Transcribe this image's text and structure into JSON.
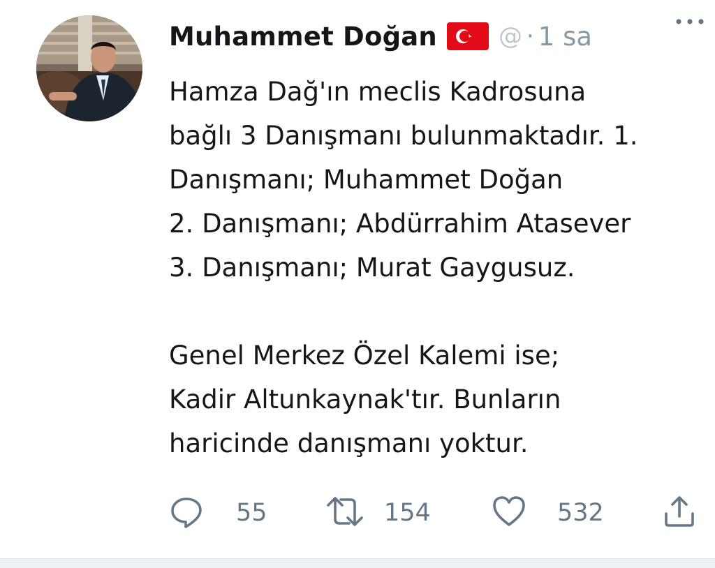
{
  "tweet": {
    "author_name": "Muhammet Doğan",
    "handle_fragment": "@",
    "separator": "·",
    "time": "1 sa",
    "flag_icon": "turkey-flag-icon",
    "more_icon": "more-dots-icon",
    "text_lines": [
      "Hamza Dağ'ın meclis Kadrosuna",
      "bağlı 3 Danışmanı bulunmaktadır. 1.",
      "Danışmanı; Muhammet Doğan",
      "2. Danışmanı; Abdürrahim Atasever",
      "3. Danışmanı; Murat Gaygusuz."
    ],
    "text_lines_2": [
      "Genel Merkez Özel Kalemi ise;",
      "Kadir Altunkaynak'tır. Bunların",
      "haricinde danışmanı yoktur."
    ],
    "actions": {
      "reply_count": "55",
      "retweet_count": "154",
      "like_count": "532"
    }
  },
  "colors": {
    "text": "#14171a",
    "muted": "#657786",
    "flag_red": "#e30a17"
  }
}
